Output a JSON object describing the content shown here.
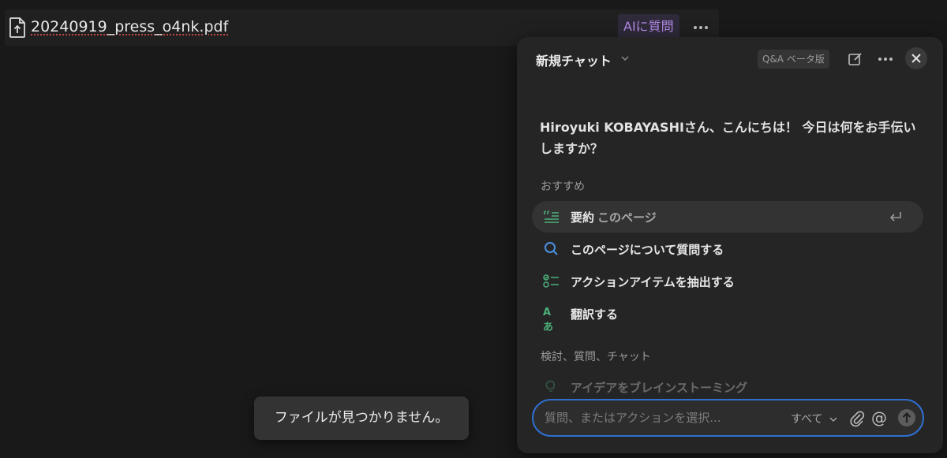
{
  "file_bar": {
    "file_name": "20240919_press_o4nk.pdf",
    "ask_ai_label": "AIに質問"
  },
  "chat_panel": {
    "title": "新規チャット",
    "beta_badge": "Q&A ベータ版",
    "greeting": "Hiroyuki KOBAYASHIさん、こんにちは！ 今日は何をお手伝いしますか？",
    "recommended_label": "おすすめ",
    "suggestions": [
      {
        "label": "要約",
        "sub": "このページ",
        "icon": "summary-icon"
      },
      {
        "label": "このページについて質問する",
        "icon": "search-icon"
      },
      {
        "label": "アクションアイテムを抽出する",
        "icon": "checklist-icon"
      },
      {
        "label": "翻訳する",
        "icon": "translate-icon"
      }
    ],
    "explore_label": "検討、質問、チャット",
    "explore_items": [
      {
        "label": "アイデアをブレインストーミング",
        "icon": "lightbulb-icon"
      }
    ],
    "input": {
      "placeholder": "質問、またはアクションを選択...",
      "scope_label": "すべて"
    }
  },
  "toast": {
    "message": "ファイルが見つかりません。"
  },
  "colors": {
    "background": "#191919",
    "panel": "#252525",
    "accent_purple": "#b48ae8",
    "focus_blue": "#2f6fcf",
    "green_icon": "#4caf7a",
    "blue_icon": "#4a8fe0"
  }
}
